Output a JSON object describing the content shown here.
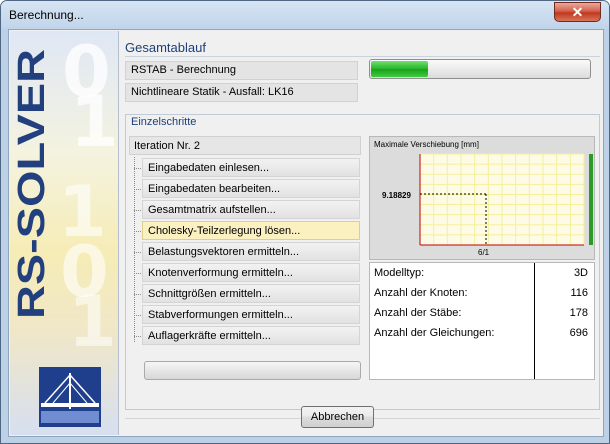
{
  "window": {
    "title": "Berechnung...",
    "close_symbol": "✕",
    "banner_text": "RS-SOLVER"
  },
  "overall": {
    "group_title": "Gesamtablauf",
    "line1": "RSTAB - Berechnung",
    "line2": "Nichtlineare Statik - Ausfall: LK16",
    "progress_fraction": 0.26,
    "progress_color": "#27b527"
  },
  "steps": {
    "group_title": "Einzelschritte",
    "iteration": "Iteration Nr. 2",
    "items": [
      {
        "label": "Eingabedaten einlesen..."
      },
      {
        "label": "Eingabedaten bearbeiten..."
      },
      {
        "label": "Gesamtmatrix aufstellen..."
      },
      {
        "label": "Cholesky-Teilzerlegung lösen..."
      },
      {
        "label": "Belastungsvektoren ermitteln..."
      },
      {
        "label": "Knotenverformung ermitteln..."
      },
      {
        "label": "Schnittgrößen ermitteln..."
      },
      {
        "label": "Stabverformungen ermitteln..."
      },
      {
        "label": "Auflagerkräfte ermitteln..."
      }
    ],
    "active_index": 3,
    "active_color": "#fbf0c0"
  },
  "chart": {
    "title": "Maximale Verschiebung [mm]",
    "y_value_label": "9.18829",
    "x_value_label": "6/1",
    "point": {
      "x": 6,
      "y": 9.18829
    },
    "grid_color": "#f5ef9c",
    "axis_color": "#c00000",
    "level_bar_color": "#2a9a2a"
  },
  "info": {
    "rows": [
      {
        "label": "Modelltyp:",
        "value": "3D"
      },
      {
        "label": "Anzahl der Knoten:",
        "value": "116"
      },
      {
        "label": "Anzahl der Stäbe:",
        "value": "178"
      },
      {
        "label": "Anzahl der Gleichungen:",
        "value": "696"
      }
    ]
  },
  "buttons": {
    "cancel": "Abbrechen"
  }
}
